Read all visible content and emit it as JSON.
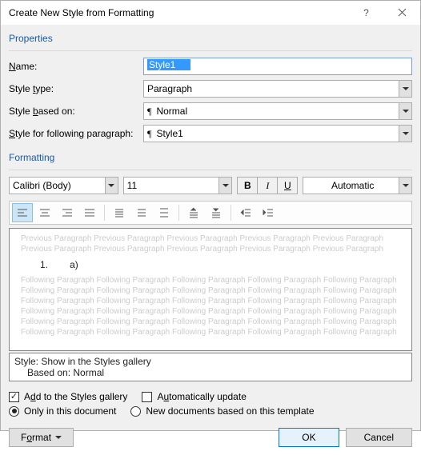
{
  "title": "Create New Style from Formatting",
  "properties": {
    "heading": "Properties",
    "name_label_pre": "",
    "name_label": "Name:",
    "name_value": "Style1",
    "styletype_label": "Style type:",
    "styletype_value": "Paragraph",
    "basedon_label_pre": "Style ",
    "basedon_label_u": "b",
    "basedon_label_post": "ased on:",
    "basedon_value": "Normal",
    "following_label_pre": "",
    "following_label_u": "S",
    "following_label_post": "tyle for following paragraph:",
    "following_value": "Style1"
  },
  "formatting": {
    "heading": "Formatting",
    "font": "Calibri (Body)",
    "size": "11",
    "color": "Automatic"
  },
  "preview": {
    "ghost_prev": "Previous Paragraph Previous Paragraph Previous Paragraph Previous Paragraph Previous Paragraph Previous Paragraph Previous Paragraph Previous Paragraph Previous Paragraph Previous Paragraph",
    "sample_num": "1.",
    "sample_let": "a)",
    "ghost_next": "Following Paragraph Following Paragraph Following Paragraph Following Paragraph Following Paragraph Following Paragraph Following Paragraph Following Paragraph Following Paragraph Following Paragraph Following Paragraph Following Paragraph Following Paragraph Following Paragraph Following Paragraph Following Paragraph Following Paragraph Following Paragraph Following Paragraph Following Paragraph Following Paragraph Following Paragraph Following Paragraph Following Paragraph Following Paragraph Following Paragraph Following Paragraph Following Paragraph Following Paragraph Following Paragraph"
  },
  "stylebox": {
    "line1": "Style: Show in the Styles gallery",
    "line2": "Based on: Normal"
  },
  "checks": {
    "add_gallery": "Add to the Styles gallery",
    "auto_update": "Automatically update",
    "only_doc": "Only in this document",
    "new_docs": "New documents based on this template"
  },
  "buttons": {
    "format": "Format",
    "ok": "OK",
    "cancel": "Cancel"
  }
}
